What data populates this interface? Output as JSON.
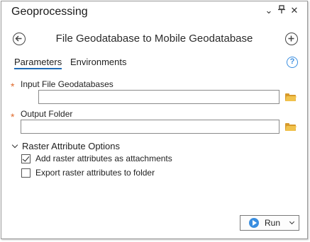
{
  "window": {
    "title": "Geoprocessing",
    "controls": {
      "menu": "⌄",
      "pin": "⊥",
      "close": "✕"
    }
  },
  "tool": {
    "title": "File Geodatabase to Mobile Geodatabase"
  },
  "tabs": [
    {
      "label": "Parameters",
      "active": true
    },
    {
      "label": "Environments",
      "active": false
    }
  ],
  "help": {
    "glyph": "?"
  },
  "parameters": {
    "required_marker": "*",
    "input": {
      "label": "Input File Geodatabases",
      "value": ""
    },
    "output": {
      "label": "Output Folder",
      "value": ""
    }
  },
  "raster_options": {
    "title": "Raster Attribute Options",
    "items": [
      {
        "label": "Add raster attributes as attachments",
        "checked": true
      },
      {
        "label": "Export raster attributes to folder",
        "checked": false
      }
    ]
  },
  "run_button": {
    "label": "Run"
  },
  "icons": {
    "back": "back-arrow-icon",
    "add": "add-icon",
    "folder": "folder-icon",
    "run": "play-icon"
  },
  "colors": {
    "accent": "#1f6bb5",
    "required": "#e06b2d",
    "folder": "#f1c24b",
    "help": "#3a8ee0"
  }
}
